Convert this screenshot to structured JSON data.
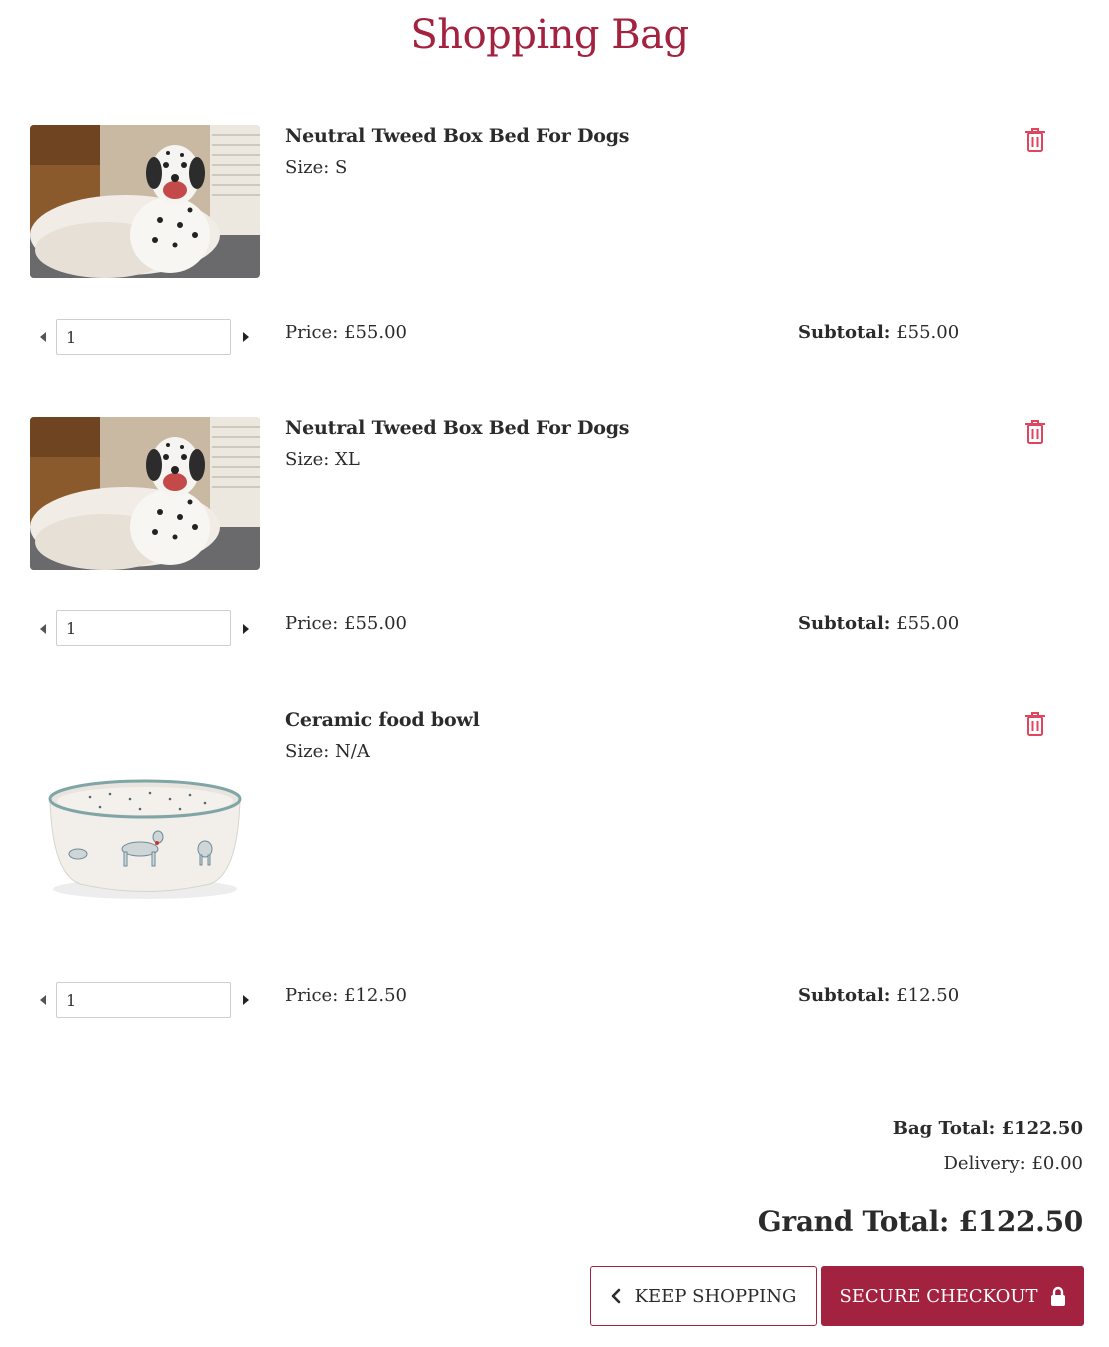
{
  "page_title": "Shopping Bag",
  "colors": {
    "brand": "#a3223f",
    "trash": "#e0455d",
    "text": "#2b2b2b"
  },
  "items": [
    {
      "name": "Neutral Tweed Box Bed For Dogs",
      "size": "Size: S",
      "image": "dalmatian-on-bed-photo",
      "quantity": "1",
      "price": "Price: £55.00",
      "subtotal_label": "Subtotal:",
      "subtotal_value": "£55.00"
    },
    {
      "name": "Neutral Tweed Box Bed For Dogs",
      "size": "Size: XL",
      "image": "dalmatian-on-bed-photo",
      "quantity": "1",
      "price": "Price: £55.00",
      "subtotal_label": "Subtotal:",
      "subtotal_value": "£55.00"
    },
    {
      "name": "Ceramic food bowl",
      "size": "Size: N/A",
      "image": "ceramic-bowl-photo",
      "quantity": "1",
      "price": "Price: £12.50",
      "subtotal_label": "Subtotal:",
      "subtotal_value": "£12.50"
    }
  ],
  "totals": {
    "bag_total": "Bag Total: £122.50",
    "delivery": "Delivery: £0.00",
    "grand_total": "Grand Total: £122.50"
  },
  "buttons": {
    "keep_shopping": "KEEP SHOPPING",
    "secure_checkout": "SECURE CHECKOUT"
  },
  "icons": {
    "remove": "trash-icon",
    "back": "chevron-left-icon",
    "lock": "lock-icon",
    "decrement": "caret-left-icon",
    "increment": "caret-right-icon"
  }
}
